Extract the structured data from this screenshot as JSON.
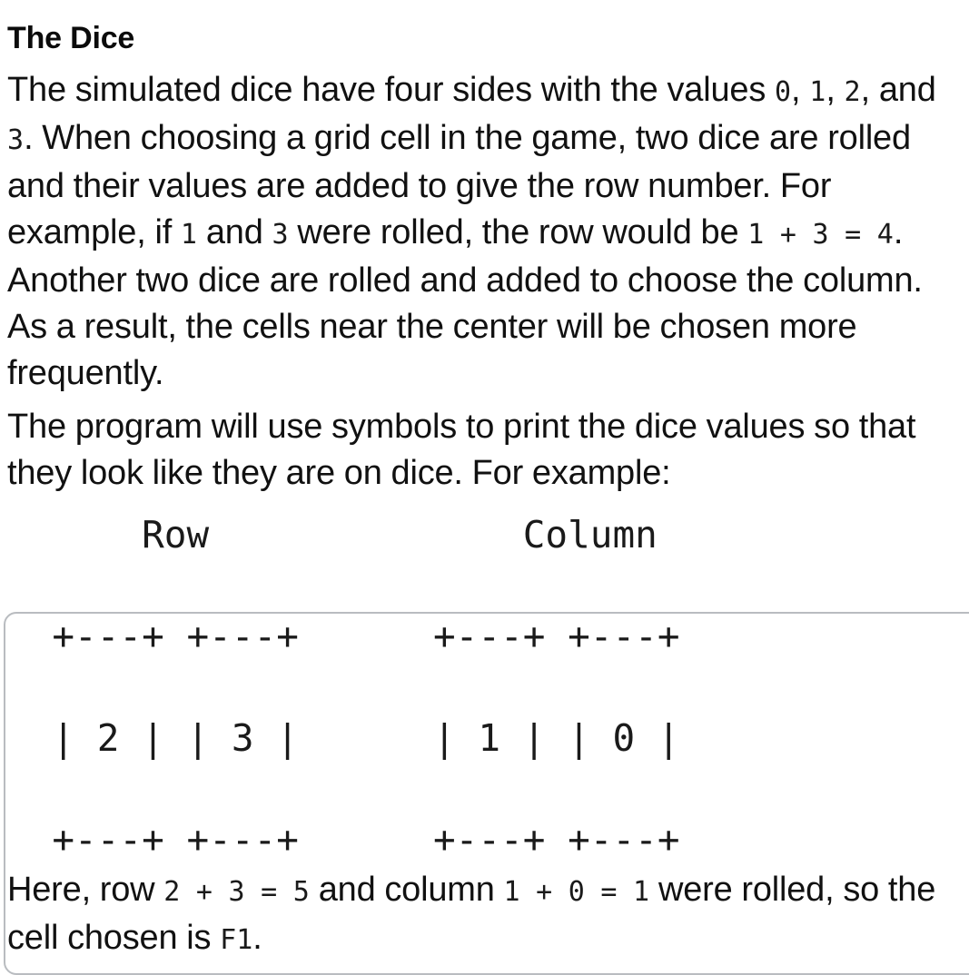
{
  "document": {
    "title": "The Dice"
  },
  "paragraphs": {
    "p1": {
      "seg1": "The simulated dice have four sides with the values ",
      "code1": "0",
      "seg2": ", ",
      "code2": "1",
      "seg3": ", ",
      "code3": "2",
      "seg4": ", and ",
      "code4": "3",
      "seg5": ".  When choosing a grid cell in the game, two dice are rolled and their values are added to give the row number.  For example, if ",
      "code5": "1",
      "seg6": " and ",
      "code6": "3",
      "seg7": " were rolled, the row would be ",
      "code7": "1 + 3 = 4",
      "seg8": ".  Another two dice are rolled and added to choose the column.  As a result, the cells near the center will be chosen more frequently."
    },
    "p2": {
      "seg1": "The program will use symbols to print the dice values so that they look like they are on dice.  For example:"
    },
    "p3": {
      "seg1": "Here, row ",
      "code1": "2 + 3 = 5",
      "seg2": " and column ",
      "code2": "1 + 0 = 1",
      "seg3": " were rolled, so the cell chosen is ",
      "code3": "F1",
      "seg4": "."
    }
  },
  "ascii_art": {
    "labels": {
      "row": "Row",
      "column": "Column"
    },
    "dice": {
      "row_die_1": "2",
      "row_die_2": "3",
      "column_die_1": "1",
      "column_die_2": "0"
    },
    "block": "      Row              Column\n\n  +---+ +---+      +---+ +---+\n\n  | 2 | | 3 |      | 1 | | 0 |\n\n  +---+ +---+      +---+ +---+"
  },
  "colors": {
    "text": "#111111",
    "heading": "#0b0b0b",
    "code": "#1a1a1a",
    "border": "#b9bcc0",
    "background": "#ffffff"
  }
}
